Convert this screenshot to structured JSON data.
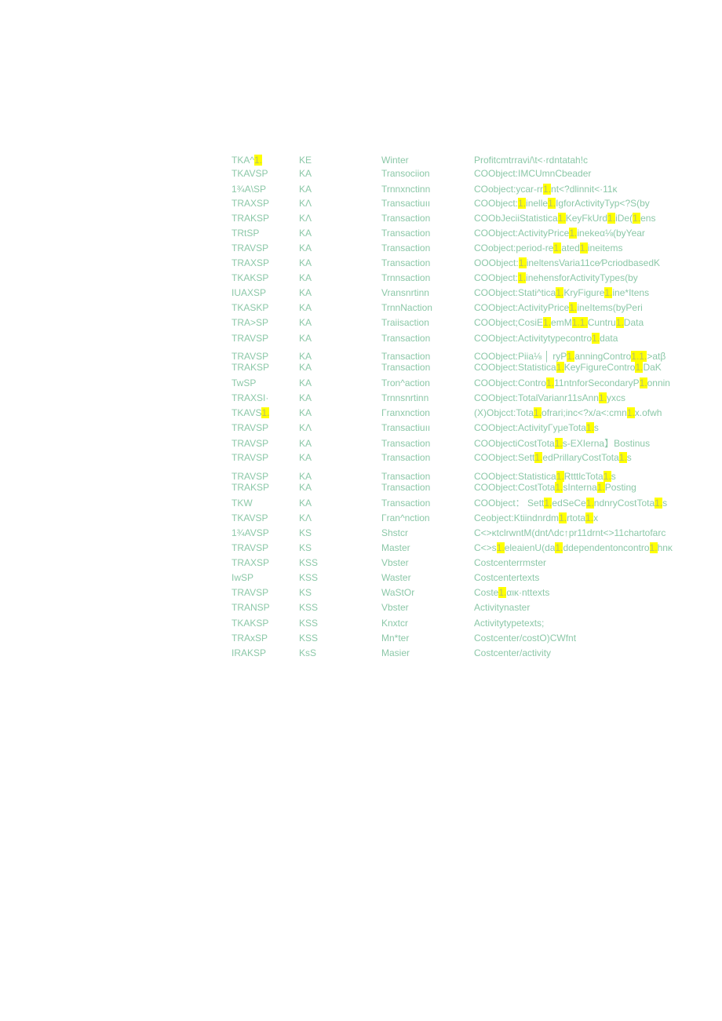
{
  "document": {
    "highlight_color": "#ffff00",
    "text_color": "#8cc8a8",
    "rows": [
      {
        "code": "TKA^1.",
        "type": "KE",
        "category": "Winter",
        "description": "Profitcmtrravi/\\t<·rdntatah!c"
      },
      {
        "code": "TKAVSP",
        "type": "KA",
        "category": "Transociion",
        "description": "COObject:IMCUmnCbeader"
      },
      {
        "code": "1¾A\\SP",
        "type": "KA",
        "category": "Trnnxnctinn",
        "description": "COobject:ycar-rr1.nt<?dlinnit<·11κ"
      },
      {
        "code": "TRAXSP",
        "type": "KΛ",
        "category": "Transactiuıı",
        "description": "COObject:1.inelle1.IgforActivityTyp<?S(by"
      },
      {
        "code": "TRAKSP",
        "type": "KΛ",
        "category": "Transaction",
        "description": "COObJeciiStatistica1.KeyFkUrd1.iDe(1.ens"
      },
      {
        "code": "TRtSP",
        "type": "KA",
        "category": "Transaction",
        "description": "COObject:ActivityPrice1.inekeα⅛(byYear"
      },
      {
        "code": "TRAVSP",
        "type": "KA",
        "category": "Transaction",
        "description": "COobject:period-re1.ated1.ineitems"
      },
      {
        "code": "TRAXSP",
        "type": "KA",
        "category": "Transaction",
        "description": "OOObject:1.ineltensVaria11ce⁄PcriodbasedK"
      },
      {
        "code": "TKAKSP",
        "type": "KA",
        "category": "Trnnsaction",
        "description": "COObject:1.inehensforActivityTypes(by"
      },
      {
        "code": "IUAXSP",
        "type": "KA",
        "category": "Vransnrtinn",
        "description": "COObject:Stati^tica1.KryFigure1.ine*Itens"
      },
      {
        "code": "TKASKP",
        "type": "KA",
        "category": "TrnnNaction",
        "description": "COObject:ActivityPrice1.ineItems(byPeri"
      },
      {
        "code": "TRA>SP",
        "type": "KA",
        "category": "Traiisaction",
        "description": "COObject;CosiE1.emM1.1.Cuntru1.Data"
      },
      {
        "code": "TRAVSP",
        "type": "KA",
        "category": "Transaction",
        "description": "COObject:Activitytypecontro1.data"
      },
      {
        "code": "TRAVSP",
        "type": "KA",
        "category": "Transaction",
        "description": "COObject:Piia⅛ │ ryP1.anningContro1.1.>atβ"
      },
      {
        "code": "TRAKSP",
        "type": "KA",
        "category": "Transaction",
        "description": "COObject:Statistica1.KeyFigureContro1.DaK"
      },
      {
        "code": "TwSP",
        "type": "KA",
        "category": "Tron^action",
        "description": "COObject:Contro1.11ntnforSecondaryP1.onnin"
      },
      {
        "code": "TRAXSI·",
        "type": "KA",
        "category": "Trnnsnrtinn",
        "description": "COObject:TotalVarianr11sAnn1.yxcs"
      },
      {
        "code": "TKAVS1.",
        "type": "KA",
        "category": "Γranxnction",
        "description": "(X)Objcct:Tota1.ofrari;inc<?x/a<:cmn1.x.ofwh"
      },
      {
        "code": "TRAVSP",
        "type": "KΛ",
        "category": "Transactiuıı",
        "description": "COObject:ActivityΓyμeTota1.s"
      },
      {
        "code": "TRAVSP",
        "type": "KA",
        "category": "Transaction",
        "description": "COObjectiCostTota1.s-EXIerna】Bostinus"
      },
      {
        "code": "TRAVSP",
        "type": "KA",
        "category": "Transaction",
        "description": "COObject:Sett1.edPrillaryCostTota1.s"
      },
      {
        "code": "TRAVSP",
        "type": "KA",
        "category": "Transaction",
        "description": "COObject:Statistica1.RtttlcTota1.s"
      },
      {
        "code": "TRAKSP",
        "type": "KA",
        "category": "Transaction",
        "description": "COObject:CostTota1.sInterna1.Posting"
      },
      {
        "code": "TKW",
        "type": "KA",
        "category": "Transaction",
        "description": "COObject： Sett1.edSeCe1.ndnryCostTota1.s"
      },
      {
        "code": "TKAVSP",
        "type": "KΛ",
        "category": "Γran^nction",
        "description": "Ceobject:Ktiindnrdm1.rtota1.x"
      },
      {
        "code": "1¾AVSP",
        "type": "KS",
        "category": "Shstcr",
        "description": "C<>κtclrwntM(dntΛdc↑pr11drnt<>11chartofarc"
      },
      {
        "code": "TRAVSP",
        "type": "KS",
        "category": "Master",
        "description": "C<>s1.eleaienU(da1.ddependentoncontro1.hnκ"
      },
      {
        "code": "TRAXSP",
        "type": "KSS",
        "category": "Vbster",
        "description": "Costcenterrmster"
      },
      {
        "code": "IwSP",
        "type": "KSS",
        "category": "Waster",
        "description": "Costcentertexts"
      },
      {
        "code": "TRAVSP",
        "type": "KS",
        "category": "WaStOr",
        "description": "Coste1.αικ·nttexts"
      },
      {
        "code": "TRANSP",
        "type": "KSS",
        "category": "Vbster",
        "description": "Activitynaster"
      },
      {
        "code": "TKAKSP",
        "type": "KSS",
        "category": "Knxtcr",
        "description": "Activitytypetexts;"
      },
      {
        "code": "TRAxSP",
        "type": "KSS",
        "category": "Mn*ter",
        "description": "Costcenter/costO)CWfnt"
      },
      {
        "code": "IRAKSP",
        "type": "KsS",
        "category": "Masier",
        "description": "Costcenter/activity"
      }
    ]
  }
}
